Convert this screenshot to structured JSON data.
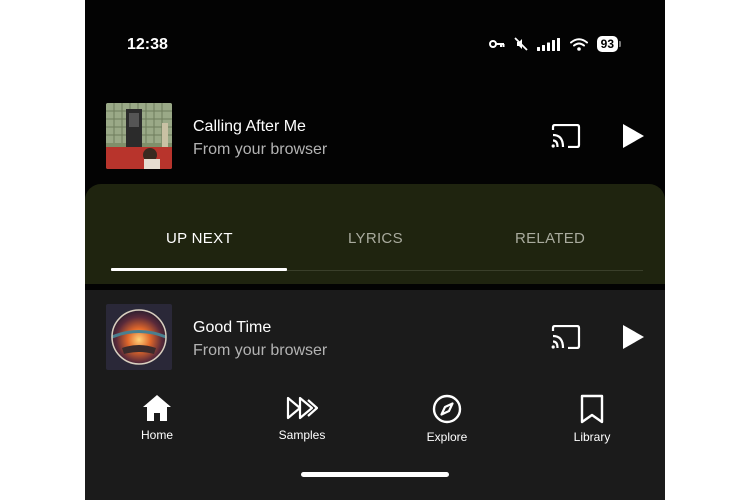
{
  "status_bar": {
    "time": "12:38",
    "battery": "93",
    "icons": [
      "vpn-key-icon",
      "muted-icon",
      "cellular-signal-icon",
      "wifi-icon",
      "battery-icon"
    ]
  },
  "now_playing": {
    "title": "Calling After Me",
    "subtitle": "From your browser"
  },
  "tabs": {
    "up_next": "UP NEXT",
    "lyrics": "LYRICS",
    "related": "RELATED",
    "active": "UP NEXT"
  },
  "mini_player": {
    "title": "Good Time",
    "subtitle": "From your browser"
  },
  "nav": {
    "home": "Home",
    "samples": "Samples",
    "explore": "Explore",
    "library": "Library"
  },
  "colors": {
    "sheet": "#1f240f",
    "background": "#030303",
    "lower_panel": "#1b1b1b"
  }
}
